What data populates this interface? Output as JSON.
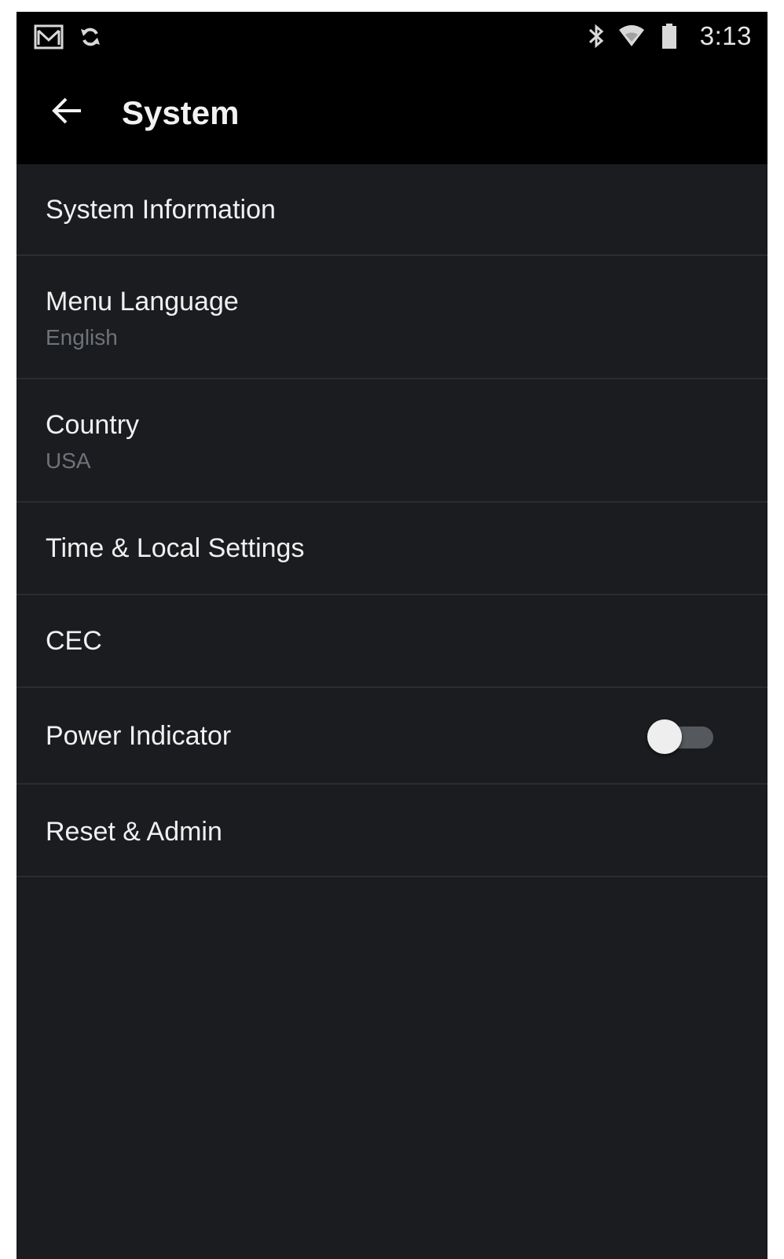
{
  "status_bar": {
    "time": "3:13",
    "left_icons": [
      "gmail-icon",
      "sync-icon"
    ],
    "right_icons": [
      "bluetooth-icon",
      "wifi-icon",
      "battery-icon"
    ]
  },
  "app_bar": {
    "back_icon": "arrow-back-icon",
    "title": "System"
  },
  "settings": {
    "items": [
      {
        "label": "System Information"
      },
      {
        "label": "Menu Language",
        "value": "English"
      },
      {
        "label": "Country",
        "value": "USA"
      },
      {
        "label": "Time & Local Settings"
      },
      {
        "label": "CEC"
      },
      {
        "label": "Power Indicator",
        "toggle_on": false
      },
      {
        "label": "Reset & Admin"
      }
    ]
  },
  "colors": {
    "background": "#1a1c1f",
    "bars": "#000000",
    "text_primary": "#f0f0f0",
    "text_secondary": "#6f7378",
    "divider": "#2a2d31"
  }
}
